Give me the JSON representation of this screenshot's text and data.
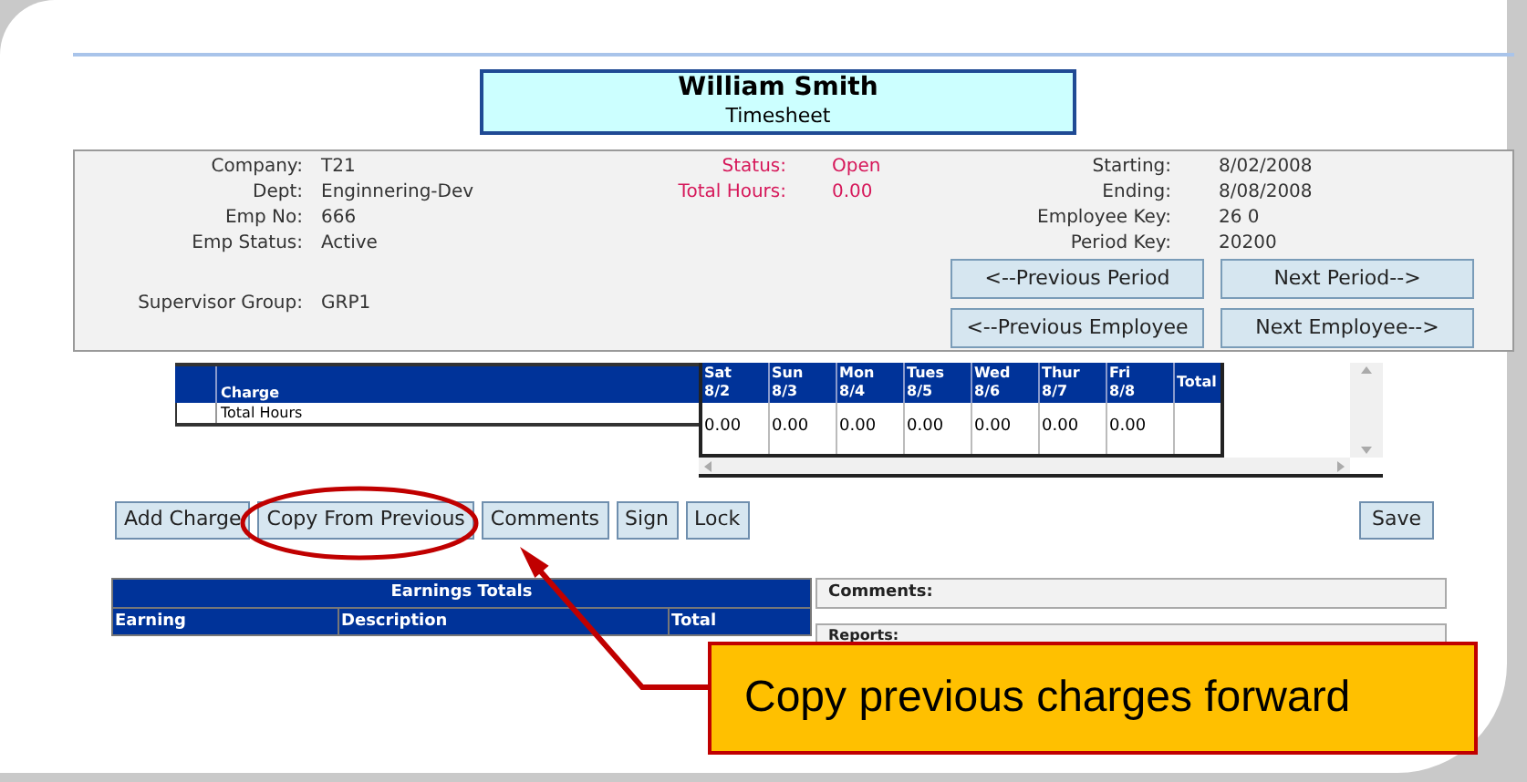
{
  "header": {
    "name": "William Smith",
    "subtitle": "Timesheet"
  },
  "employee": [
    {
      "label": "Company:",
      "value": "T21"
    },
    {
      "label": "Dept:",
      "value": "Enginnering-Dev"
    },
    {
      "label": "Emp No:",
      "value": "666"
    },
    {
      "label": "Emp Status:",
      "value": "Active"
    }
  ],
  "supervisor": {
    "label": "Supervisor Group:",
    "value": "GRP1"
  },
  "status": [
    {
      "label": "Status:",
      "value": "Open"
    },
    {
      "label": "Total Hours:",
      "value": "0.00"
    }
  ],
  "period": [
    {
      "label": "Starting:",
      "value": "8/02/2008"
    },
    {
      "label": "Ending:",
      "value": "8/08/2008"
    },
    {
      "label": "Employee Key:",
      "value": "26 0"
    },
    {
      "label": "Period Key:",
      "value": "20200"
    }
  ],
  "nav_buttons": [
    "<--Previous Period",
    "Next Period-->",
    "<--Previous Employee",
    "Next Employee-->"
  ],
  "grid": {
    "charge_column": "Charge",
    "rows": [
      "Total Hours"
    ],
    "total_column": "Total",
    "days": [
      {
        "day": "Sat",
        "date": "8/2",
        "hours": "0.00"
      },
      {
        "day": "Sun",
        "date": "8/3",
        "hours": "0.00"
      },
      {
        "day": "Mon",
        "date": "8/4",
        "hours": "0.00"
      },
      {
        "day": "Tues",
        "date": "8/5",
        "hours": "0.00"
      },
      {
        "day": "Wed",
        "date": "8/6",
        "hours": "0.00"
      },
      {
        "day": "Thur",
        "date": "8/7",
        "hours": "0.00"
      },
      {
        "day": "Fri",
        "date": "8/8",
        "hours": "0.00"
      }
    ]
  },
  "actions": [
    "Add Charge",
    "Copy From Previous",
    "Comments",
    "Sign",
    "Lock"
  ],
  "save": "Save",
  "earnings": {
    "title": "Earnings Totals",
    "columns": [
      "Earning",
      "Description",
      "Total"
    ]
  },
  "comments_label": "Comments:",
  "reports_label": "Reports:",
  "callout": "Copy previous charges forward"
}
